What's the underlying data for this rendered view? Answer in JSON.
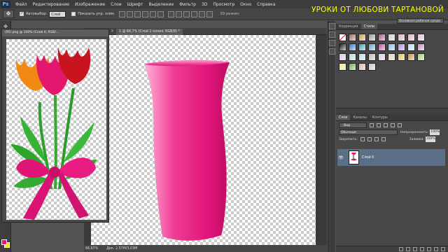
{
  "app": {
    "logo": "Ps"
  },
  "menu": [
    "Файл",
    "Редактирование",
    "Изображение",
    "Слои",
    "Шрифт",
    "Выделение",
    "Фильтр",
    "3D",
    "Просмотр",
    "Окно",
    "Справка"
  ],
  "watermark": "УРОКИ ОТ ЛЮБОВИ ТАРТАНОВОЙ",
  "options": {
    "autoselect_label": "Автовыбор:",
    "autoselect_target": "Слой",
    "show_controls_label": "Показать упр. элем.",
    "mode_3d": "3D-режим:",
    "workspace": "Основная рабочая среда"
  },
  "tulip_doc": {
    "title": "(95).png @ 100% (Слой 0, RGB/..."
  },
  "main_doc": {
    "tab_title": "1 @ 66,7% (Слой 1 копия, RGB/8) *",
    "zoom": "66,67%",
    "doc_size": "Док: 2,57М/3,03М"
  },
  "styles_panel": {
    "tabs": [
      "Коррекция",
      "Стили"
    ],
    "swatch_colors": [
      "#d8d8d8",
      "#9e6a54",
      "#c9a046",
      "#9b9b9b",
      "#b14e8e",
      "#cfcfcf",
      "#e0b0b0",
      "#dfb3c6",
      "#e7bde4",
      "#1c1c1c",
      "#2f7ad1",
      "#3aa5b2",
      "#6aa2d8",
      "#c44fa2",
      "#86c4e3",
      "#a88ee7",
      "#b7e3f0",
      "#c98cc8",
      "#e0c1ef",
      "#a9e1e6",
      "#c8d7ee",
      "#b9b9b9",
      "#ddc8ee",
      "#ecd0bf",
      "#e8c24a",
      "#d08a35",
      "#9ed46b",
      "#f4ec7c",
      "#6ab04c",
      "#e4b6a2",
      "#c7c7c7"
    ]
  },
  "layers_panel": {
    "tabs": [
      "Слои",
      "Каналы",
      "Контуры"
    ],
    "kind": "Вид",
    "blend_mode": "Обычные",
    "opacity_label": "Непрозрачность:",
    "opacity": "100%",
    "lock_label": "Закрепить:",
    "fill_label": "Заливка:",
    "fill": "100%",
    "layers": [
      {
        "name": "Слой 0",
        "visible": true
      }
    ]
  },
  "colors": {
    "foreground": "#e8117a",
    "background": "#f7e600",
    "accent_title": "#ffff00",
    "vase": "#e0157a"
  }
}
